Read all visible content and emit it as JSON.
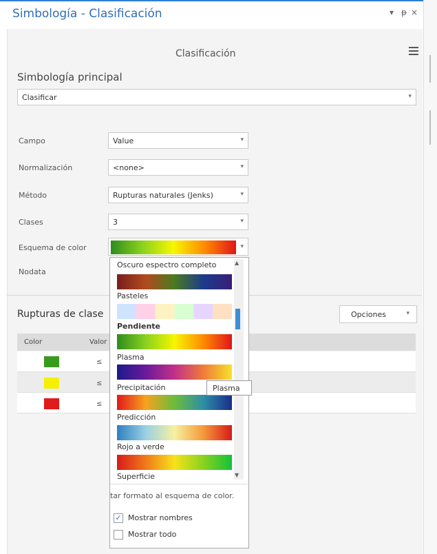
{
  "window": {
    "title": "Simbología - Clasificación",
    "controls": [
      "▾",
      "ᵽ",
      "×"
    ]
  },
  "header": {
    "subtitle": "Clasificación"
  },
  "primary": {
    "label": "Simbología principal",
    "value": "Clasificar"
  },
  "fields": {
    "campo": {
      "label": "Campo",
      "value": "Value"
    },
    "normalizacion": {
      "label": "Normalización",
      "value": "<none>"
    },
    "metodo": {
      "label": "Método",
      "value": "Rupturas naturales (Jenks)"
    },
    "clases": {
      "label": "Clases",
      "value": "3"
    },
    "esquema": {
      "label": "Esquema de color"
    },
    "nodata": {
      "label": "Nodata"
    }
  },
  "breaks": {
    "title": "Rupturas de clase",
    "options_label": "Opciones",
    "columns": [
      "Color",
      "Valor"
    ],
    "rows": [
      {
        "color": "#3a9a1f",
        "value": "≤"
      },
      {
        "color": "#f3f000",
        "value": "≤"
      },
      {
        "color": "#e11a1a",
        "value": "≤"
      }
    ]
  },
  "palette_menu": {
    "items": [
      {
        "label": "Oscuro espectro completo",
        "gradient": [
          "#7a1e1e",
          "#b24a1e",
          "#4a7a20",
          "#1c3b8a",
          "#3a1e7a"
        ]
      },
      {
        "label": "Pasteles",
        "gradient": [
          "#cfe3ff",
          "#ffd1e8",
          "#fff2c2",
          "#d7ffd2",
          "#e6d6ff",
          "#ffe0c2"
        ]
      },
      {
        "label": "Pendiente",
        "gradient": [
          "#2e8b1f",
          "#8ad21e",
          "#f6f600",
          "#ff8a00",
          "#e0161a"
        ]
      },
      {
        "label": "Plasma",
        "gradient": [
          "#1a1a8a",
          "#6a1a9a",
          "#c2308a",
          "#f07a3a",
          "#f7e22a"
        ]
      },
      {
        "label": "Precipitación",
        "gradient": [
          "#e01a1a",
          "#f7a21e",
          "#6bbd3a",
          "#2d8ea6",
          "#1a2d8a"
        ]
      },
      {
        "label": "Predicción",
        "gradient": [
          "#2f7fc2",
          "#9ad0e3",
          "#f7f0a0",
          "#f59a3a",
          "#d81a1a"
        ]
      },
      {
        "label": "Rojo a verde",
        "gradient": [
          "#d81a1a",
          "#f07a1a",
          "#f7e21a",
          "#8ad21e",
          "#12c23a"
        ]
      },
      {
        "label": "Superficie",
        "gradient": [
          "#2e8b1f",
          "#f7f000",
          "#f79a1a",
          "#d81a1a"
        ]
      }
    ],
    "hint": "tar formato al esquema de color.",
    "show_names": "Mostrar nombres",
    "show_all": "Mostrar todo",
    "show_names_checked": true,
    "show_all_checked": false
  },
  "tooltip": "Plasma",
  "icons": {
    "menu": "hamburger-icon",
    "dropdown": "chevron-down-icon",
    "scroll_up": "scroll-up-icon",
    "scroll_down": "scroll-down-icon"
  }
}
